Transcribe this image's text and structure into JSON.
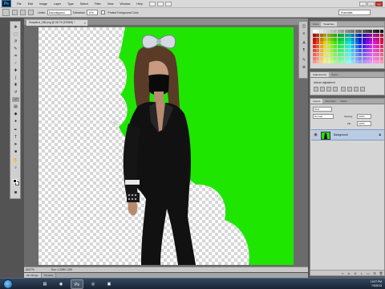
{
  "app": {
    "logo": "Ps",
    "menu": [
      "File",
      "Edit",
      "Image",
      "Layer",
      "Type",
      "Select",
      "Filter",
      "View",
      "Window",
      "Help"
    ]
  },
  "options_bar": {
    "mode_label": "Limits:",
    "mode_value": "Discontiguous",
    "tolerance_label": "Tolerance:",
    "tolerance_value": "10%",
    "protect_label": "Protect Foreground Color",
    "workspace": "Essentials"
  },
  "document": {
    "tab_title": "Snapshot_186.png @ 66.7% (RGB/8) *",
    "zoom": "66.67%",
    "doc_size": "Doc: 1.22M/1.22M",
    "canvas_color": "#1ee600"
  },
  "mini_bridge": [
    "Mini Bridge",
    "Timeline"
  ],
  "panels": {
    "top_tabs": [
      "Color",
      "Swatches"
    ],
    "mid_tabs": [
      "Adjustments",
      "Styles"
    ],
    "adjust_title": "Add an adjustment",
    "layer_tabs": [
      "Layers",
      "Channels",
      "Paths"
    ],
    "kind_filter": "Kind",
    "blend_mode": "Normal",
    "opacity_label": "Opacity:",
    "opacity_value": "100%",
    "fill_label": "Fill:",
    "fill_value": "100%",
    "layer_name": "Background",
    "layer_thumb_color": "#2bdc16"
  },
  "taskbar": {
    "apps": [
      "explorer-icon",
      "firefox-icon",
      "photoshop-icon",
      "chrome-icon",
      "app-icon"
    ],
    "time": "10:07 PM",
    "date": "7/9/2013"
  },
  "icons": {
    "tools": [
      "move-icon",
      "marquee-icon",
      "lasso-icon",
      "quick-select-icon",
      "crop-icon",
      "eyedropper-icon",
      "healing-icon",
      "brush-icon",
      "stamp-icon",
      "history-brush-icon",
      "eraser-icon",
      "gradient-icon",
      "blur-icon",
      "dodge-icon",
      "pen-icon",
      "type-icon",
      "path-select-icon",
      "shape-icon",
      "hand-icon",
      "zoom-icon"
    ]
  }
}
